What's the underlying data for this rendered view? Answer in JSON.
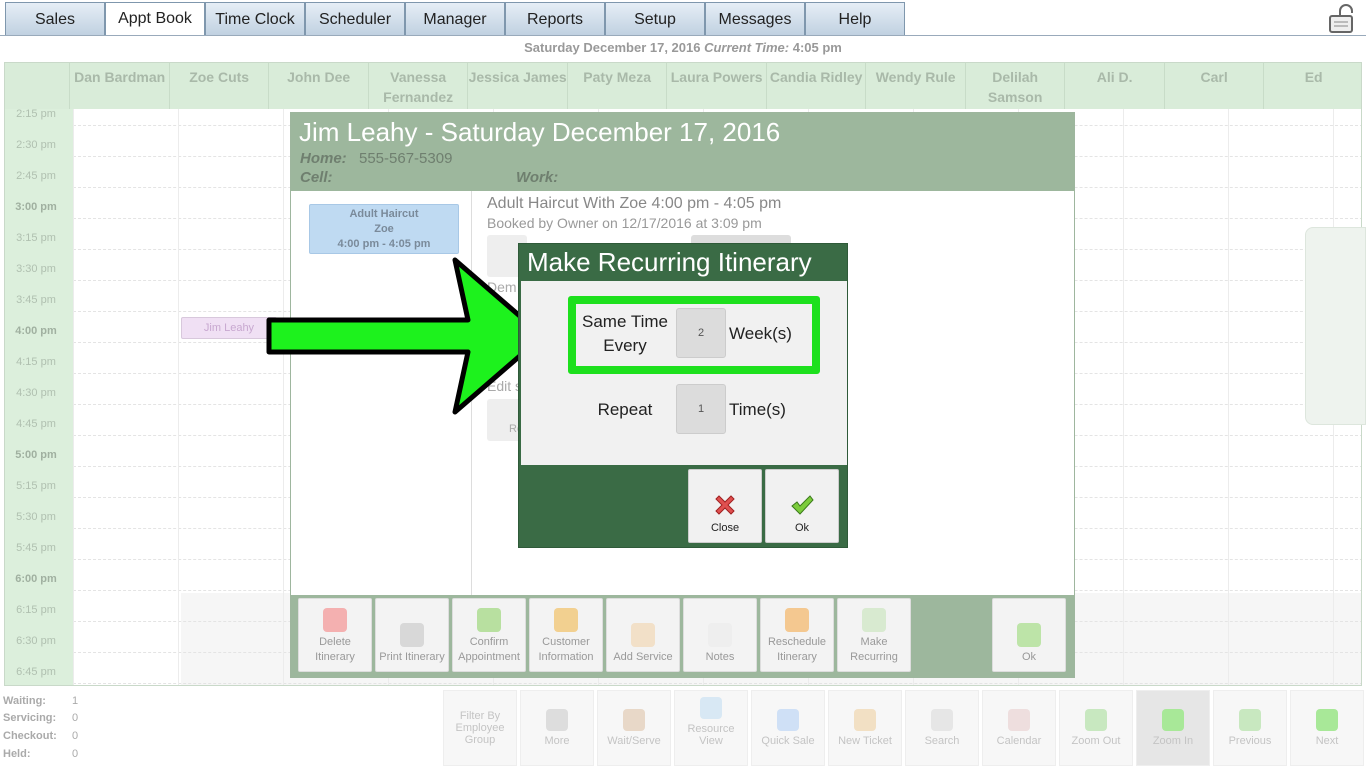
{
  "nav": {
    "tabs": [
      "Sales",
      "Appt Book",
      "Time Clock",
      "Scheduler",
      "Manager",
      "Reports",
      "Setup",
      "Messages",
      "Help"
    ],
    "active": "Appt Book"
  },
  "header": {
    "date": "Saturday December 17, 2016",
    "current_time_label": "Current Time:",
    "current_time": "4:05 pm"
  },
  "grid": {
    "employees": [
      "Dan Bardman",
      "Zoe Cuts",
      "John Dee",
      "Vanessa Fernandez",
      "Jessica James",
      "Paty Meza",
      "Laura Powers",
      "Candia Ridley",
      "Wendy Rule",
      "Delilah Samson",
      "Ali D.",
      "Carl",
      "Ed"
    ],
    "times": [
      "2:15 pm",
      "2:30 pm",
      "2:45 pm",
      "3:00 pm",
      "3:15 pm",
      "3:30 pm",
      "3:45 pm",
      "4:00 pm",
      "4:15 pm",
      "4:30 pm",
      "4:45 pm",
      "5:00 pm",
      "5:15 pm",
      "5:30 pm",
      "5:45 pm",
      "6:00 pm",
      "6:15 pm",
      "6:30 pm",
      "6:45 pm"
    ],
    "appointment_label": "Jim Leahy"
  },
  "status": {
    "waiting_label": "Waiting:",
    "waiting": "1",
    "servicing_label": "Servicing:",
    "servicing": "0",
    "checkout_label": "Checkout:",
    "checkout": "0",
    "held_label": "Held:",
    "held": "0"
  },
  "toolbar": [
    "Filter By Employee Group",
    "More",
    "Wait/Serve",
    "Resource View",
    "Quick Sale",
    "New Ticket",
    "Search",
    "Calendar",
    "Zoom Out",
    "Zoom In",
    "Previous",
    "Next"
  ],
  "itinerary": {
    "title": "Jim Leahy - Saturday December 17, 2016",
    "home_label": "Home:",
    "home_phone": "555-567-5309",
    "cell_label": "Cell:",
    "work_label": "Work:",
    "card": {
      "service": "Adult Haircut",
      "employee": "Zoe",
      "time": "4:00 pm - 4:05 pm"
    },
    "service_title": "Adult Haircut With Zoe 4:00 pm - 4:05 pm",
    "booked_by": "Booked by Owner on 12/17/2016 at 3:09 pm",
    "partial_1": "Dem",
    "partial_2": "Edit s",
    "partial_3": "Re",
    "footer": [
      "Delete Itinerary",
      "Print Itinerary",
      "Confirm Appointment",
      "Customer Information",
      "Add Service",
      "Notes",
      "Reschedule Itinerary",
      "Make Recurring",
      "Ok"
    ]
  },
  "recurring": {
    "title": "Make Recurring Itinerary",
    "same_time_label": "Same Time Every",
    "weeks_value": "2",
    "weeks_unit": "Week(s)",
    "repeat_label": "Repeat",
    "times_value": "1",
    "times_unit": "Time(s)",
    "close_label": "Close",
    "ok_label": "Ok"
  },
  "colors": {
    "highlight": "#1de01d",
    "dialog_green": "#3a6b45",
    "header_green": "#9db79d"
  }
}
